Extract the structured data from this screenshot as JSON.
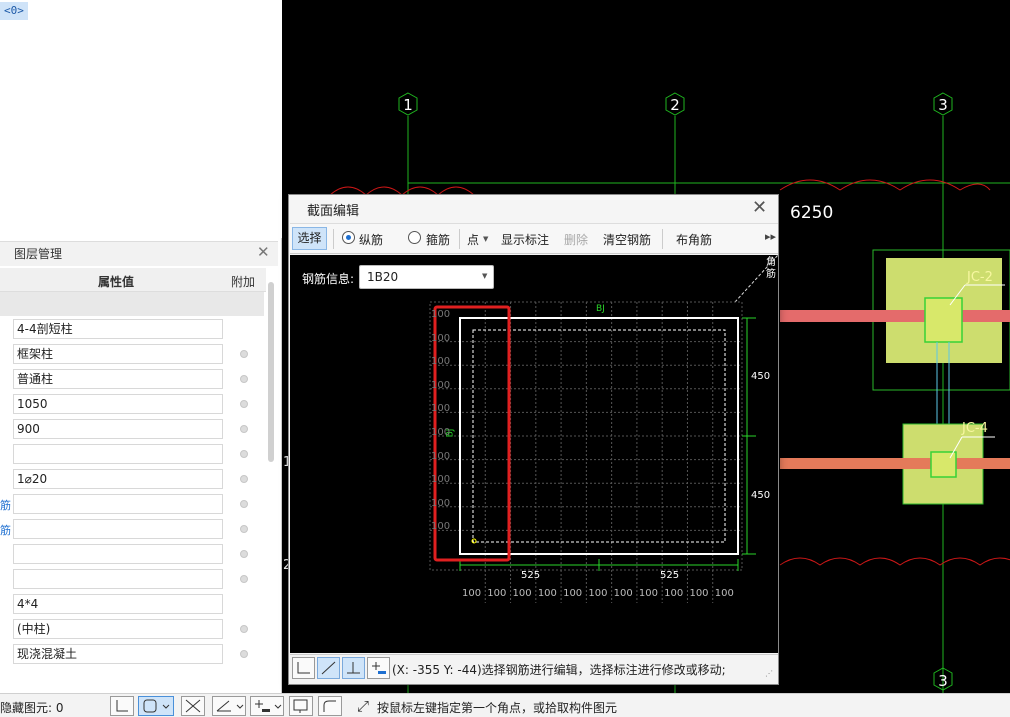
{
  "tree": {
    "badge": "<0>"
  },
  "layer_panel": {
    "title": "图层管理",
    "close_icon": "close-icon",
    "col_value": "属性值",
    "col_attach": "附加"
  },
  "properties": [
    {
      "side_label": "",
      "value": "4-4剖短柱",
      "attach": false
    },
    {
      "side_label": "",
      "value": "框架柱",
      "attach": true
    },
    {
      "side_label": "",
      "value": "普通柱",
      "attach": true
    },
    {
      "side_label": "",
      "value": "1050",
      "attach": true
    },
    {
      "side_label": "",
      "value": "900",
      "attach": true
    },
    {
      "side_label": "",
      "value": "",
      "attach": true
    },
    {
      "side_label": "",
      "value": "1⌀20",
      "attach": true
    },
    {
      "side_label": "筋",
      "value": "",
      "attach": true
    },
    {
      "side_label": "筋",
      "value": "",
      "attach": true
    },
    {
      "side_label": "",
      "value": "",
      "attach": true
    },
    {
      "side_label": "",
      "value": "",
      "attach": true
    },
    {
      "side_label": "",
      "value": "4*4",
      "attach": false
    },
    {
      "side_label": "",
      "value": "(中柱)",
      "attach": true
    },
    {
      "side_label": "",
      "value": "现浇混凝土",
      "attach": true
    }
  ],
  "cad": {
    "axis_labels": [
      "1",
      "2",
      "3"
    ],
    "dimension": "6250",
    "components": [
      "JC-2",
      "JC-4"
    ],
    "left_marks": [
      "1",
      "2"
    ],
    "bottom_axis": "3"
  },
  "dialog": {
    "title": "截面编辑",
    "toolbar": {
      "select": "选择",
      "longitudinal": "纵筋",
      "stirrup": "箍筋",
      "point": "点",
      "show_dims": "显示标注",
      "delete": "删除",
      "clear_rebar": "清空钢筋",
      "corner_rebar": "布角筋"
    },
    "rebar_info_label": "钢筋信息:",
    "rebar_info_value": "1B20",
    "corner_label": "角筋",
    "section": {
      "width_dims": [
        "525",
        "525"
      ],
      "height_dims": [
        "450",
        "450"
      ],
      "grid_dim": "100",
      "top_tag": "BJ",
      "side_tag": "BJ"
    },
    "bottom_hint": "(X: -355 Y: -44)选择钢筋进行编辑，选择标注进行修改或移动;"
  },
  "status": {
    "hidden_label": "隐藏图元: 0",
    "hint": "按鼠标左键指定第一个角点，或拾取构件图元"
  }
}
